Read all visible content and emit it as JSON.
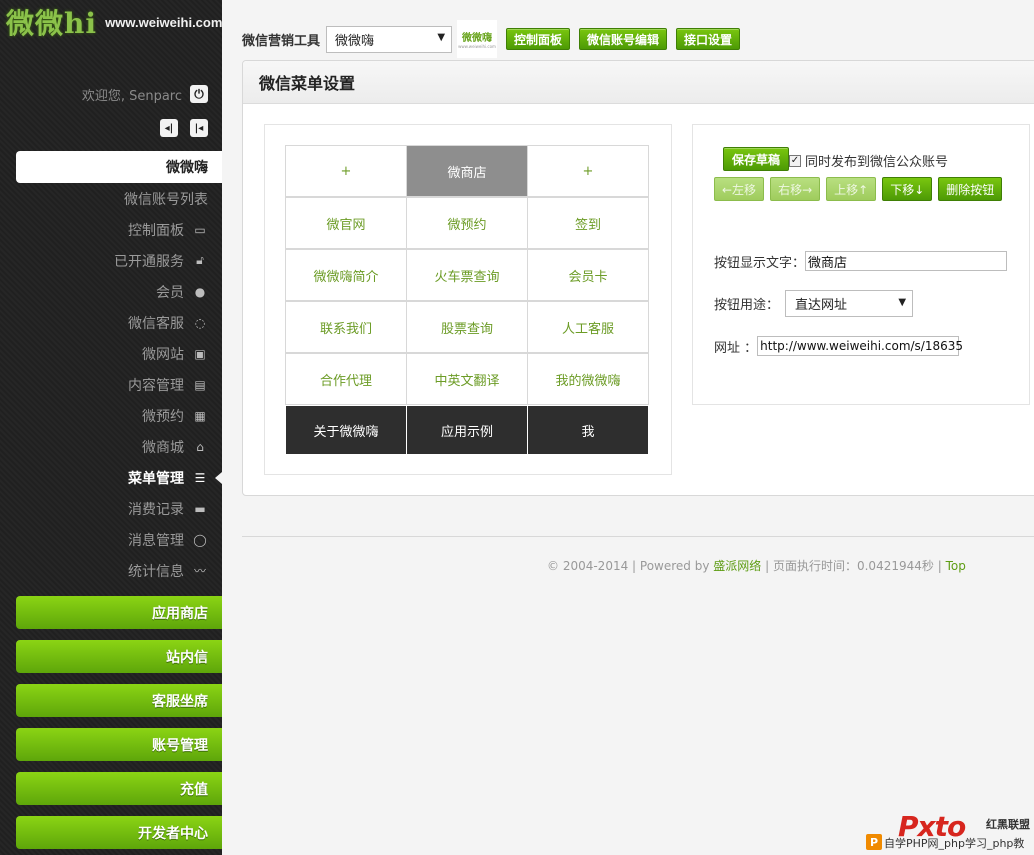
{
  "logo": {
    "mark": "微微hi",
    "url": "www.weiweihi.com"
  },
  "sidebar": {
    "welcome": "欢迎您, Senparc",
    "account_tab": "微微嗨",
    "nav": [
      {
        "label": "微信账号列表",
        "icon": ""
      },
      {
        "label": "控制面板",
        "icon": "monitor-icon"
      },
      {
        "label": "已开通服务",
        "icon": "lock-icon"
      },
      {
        "label": "会员",
        "icon": "user-icon"
      },
      {
        "label": "微信客服",
        "icon": "headset-icon"
      },
      {
        "label": "微网站",
        "icon": "web-icon"
      },
      {
        "label": "内容管理",
        "icon": "content-icon"
      },
      {
        "label": "微预约",
        "icon": "calendar-icon"
      },
      {
        "label": "微商城",
        "icon": "bag-icon"
      },
      {
        "label": "菜单管理",
        "icon": "menu-icon"
      },
      {
        "label": "消费记录",
        "icon": "card-icon"
      },
      {
        "label": "消息管理",
        "icon": "chat-icon"
      },
      {
        "label": "统计信息",
        "icon": "chart-icon"
      }
    ],
    "active_nav": "菜单管理",
    "green_menu": [
      "应用商店",
      "站内信",
      "客服坐席",
      "账号管理",
      "充值",
      "开发者中心"
    ]
  },
  "topbar": {
    "tool_label": "微信营销工具",
    "account_selected": "微微嗨",
    "account_logo_title": "微微嗨",
    "account_logo_sub": "www.weiweihi.com",
    "buttons": [
      "控制面板",
      "微信账号编辑",
      "接口设置"
    ]
  },
  "panel": {
    "title": "微信菜单设置",
    "grid": [
      [
        "+",
        "微商店",
        "+"
      ],
      [
        "微官网",
        "微预约",
        "签到"
      ],
      [
        "微微嗨简介",
        "火车票查询",
        "会员卡"
      ],
      [
        "联系我们",
        "股票查询",
        "人工客服"
      ],
      [
        "合作代理",
        "中英文翻译",
        "我的微微嗨"
      ]
    ],
    "main_buttons": [
      "关于微微嗨",
      "应用示例",
      "我"
    ],
    "selected_cell": "微商店"
  },
  "editor": {
    "save_draft": "保存草稿",
    "publish_label": "同时发布到微信公众账号",
    "publish_checked": true,
    "move_buttons": [
      {
        "label": "←左移",
        "enabled": false
      },
      {
        "label": "右移→",
        "enabled": false
      },
      {
        "label": "上移↑",
        "enabled": false
      },
      {
        "label": "下移↓",
        "enabled": true
      },
      {
        "label": "删除按钮",
        "enabled": true
      }
    ],
    "label_field_label": "按钮显示文字：",
    "label_field_value": "微商店",
    "usage_label": "按钮用途：",
    "usage_value": "直达网址",
    "url_label": "网址 ：",
    "url_value": "http://www.weiweihi.com/s/18635"
  },
  "footer": {
    "copyright": "© 2004-2014 | Powered by",
    "company": "盛派网络",
    "exec_time": "| 页面执行时间：0.0421944秒 |",
    "top_link": "Top"
  },
  "watermark": {
    "logo": "Pxto",
    "brand": "红黑联盟",
    "p_badge": "P",
    "text": "自学PHP网_php学习_php教"
  },
  "colors": {
    "accent_green": "#5ea60a",
    "sidebar_bg": "#262626",
    "selected_cell": "#8e8e8e",
    "main_row": "#2e2e2e"
  }
}
